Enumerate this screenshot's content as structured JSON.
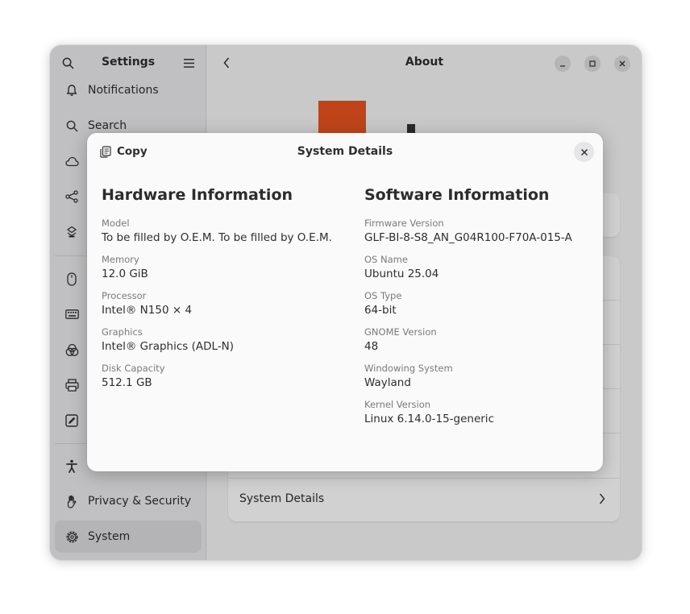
{
  "sidebar": {
    "title": "Settings",
    "items": [
      {
        "label": "Notifications",
        "icon": "bell-icon"
      },
      {
        "label": "Search",
        "icon": "search-icon"
      },
      {
        "label": "",
        "icon": "cloud-icon"
      },
      {
        "label": "",
        "icon": "share-icon"
      },
      {
        "label": "",
        "icon": "apps-icon"
      },
      {
        "label": "",
        "icon": "mouse-icon"
      },
      {
        "label": "",
        "icon": "keyboard-icon"
      },
      {
        "label": "",
        "icon": "color-icon"
      },
      {
        "label": "",
        "icon": "printer-icon"
      },
      {
        "label": "",
        "icon": "pen-tablet-icon"
      },
      {
        "label": "",
        "icon": "accessibility-icon"
      },
      {
        "label": "Privacy & Security",
        "icon": "hand-icon"
      },
      {
        "label": "System",
        "icon": "gear-icon"
      }
    ]
  },
  "content": {
    "title": "About",
    "system_details_label": "System Details"
  },
  "dialog": {
    "copy_label": "Copy",
    "title": "System Details",
    "hardware": {
      "heading": "Hardware Information",
      "fields": [
        {
          "key": "Model",
          "value": "To be filled by O.E.M. To be filled by O.E.M."
        },
        {
          "key": "Memory",
          "value": "12.0 GiB"
        },
        {
          "key": "Processor",
          "value": "Intel® N150 × 4"
        },
        {
          "key": "Graphics",
          "value": "Intel® Graphics (ADL-N)"
        },
        {
          "key": "Disk Capacity",
          "value": "512.1 GB"
        }
      ]
    },
    "software": {
      "heading": "Software Information",
      "fields": [
        {
          "key": "Firmware Version",
          "value": "GLF-BI-8-S8_AN_G04R100-F70A-015-A"
        },
        {
          "key": "OS Name",
          "value": "Ubuntu 25.04"
        },
        {
          "key": "OS Type",
          "value": "64-bit"
        },
        {
          "key": "GNOME Version",
          "value": "48"
        },
        {
          "key": "Windowing System",
          "value": "Wayland"
        },
        {
          "key": "Kernel Version",
          "value": "Linux 6.14.0-15-generic"
        }
      ]
    }
  },
  "colors": {
    "accent": "#e95420",
    "sidebar_bg": "#ebebed",
    "dialog_bg": "#fafafb"
  }
}
